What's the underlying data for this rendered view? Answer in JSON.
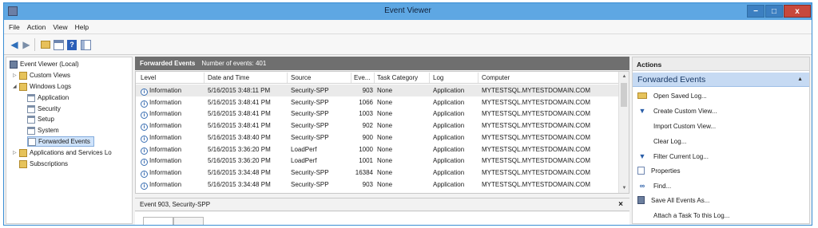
{
  "window": {
    "title": "Event Viewer",
    "controls": {
      "minimize": "−",
      "maximize": "□",
      "close": "x"
    }
  },
  "menu": [
    "File",
    "Action",
    "View",
    "Help"
  ],
  "tree": {
    "root": "Event Viewer (Local)",
    "custom_views": "Custom Views",
    "windows_logs": "Windows Logs",
    "application": "Application",
    "security": "Security",
    "setup": "Setup",
    "system": "System",
    "forwarded_events": "Forwarded Events",
    "apps_services": "Applications and Services Lo",
    "subscriptions": "Subscriptions"
  },
  "center": {
    "title": "Forwarded Events",
    "count_text": "Number of events: 401",
    "columns": [
      "Level",
      "Date and Time",
      "Source",
      "Eve...",
      "Task Category",
      "Log",
      "Computer"
    ],
    "rows": [
      [
        "Information",
        "5/16/2015 3:48:11 PM",
        "Security-SPP",
        "903",
        "None",
        "Application",
        "MYTESTSQL.MYTESTDOMAIN.COM"
      ],
      [
        "Information",
        "5/16/2015 3:48:41 PM",
        "Security-SPP",
        "1066",
        "None",
        "Application",
        "MYTESTSQL.MYTESTDOMAIN.COM"
      ],
      [
        "Information",
        "5/16/2015 3:48:41 PM",
        "Security-SPP",
        "1003",
        "None",
        "Application",
        "MYTESTSQL.MYTESTDOMAIN.COM"
      ],
      [
        "Information",
        "5/16/2015 3:48:41 PM",
        "Security-SPP",
        "902",
        "None",
        "Application",
        "MYTESTSQL.MYTESTDOMAIN.COM"
      ],
      [
        "Information",
        "5/16/2015 3:48:40 PM",
        "Security-SPP",
        "900",
        "None",
        "Application",
        "MYTESTSQL.MYTESTDOMAIN.COM"
      ],
      [
        "Information",
        "5/16/2015 3:36:20 PM",
        "LoadPerf",
        "1000",
        "None",
        "Application",
        "MYTESTSQL.MYTESTDOMAIN.COM"
      ],
      [
        "Information",
        "5/16/2015 3:36:20 PM",
        "LoadPerf",
        "1001",
        "None",
        "Application",
        "MYTESTSQL.MYTESTDOMAIN.COM"
      ],
      [
        "Information",
        "5/16/2015 3:34:48 PM",
        "Security-SPP",
        "16384",
        "None",
        "Application",
        "MYTESTSQL.MYTESTDOMAIN.COM"
      ],
      [
        "Information",
        "5/16/2015 3:34:48 PM",
        "Security-SPP",
        "903",
        "None",
        "Application",
        "MYTESTSQL.MYTESTDOMAIN.COM"
      ]
    ]
  },
  "detail": {
    "title": "Event 903, Security-SPP",
    "close": "×"
  },
  "actions": {
    "header": "Actions",
    "section": "Forwarded Events",
    "items": [
      "Open Saved Log...",
      "Create Custom View...",
      "Import Custom View...",
      "Clear Log...",
      "Filter Current Log...",
      "Properties",
      "Find...",
      "Save All Events As...",
      "Attach a Task To this Log..."
    ]
  }
}
